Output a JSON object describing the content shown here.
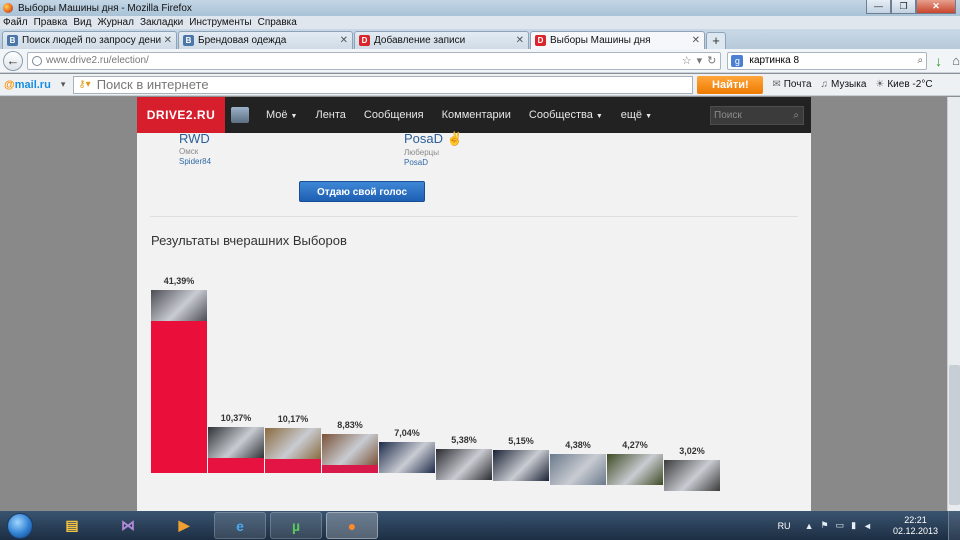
{
  "window": {
    "title": "Выборы Машины дня - Mozilla Firefox"
  },
  "menu": [
    "Файл",
    "Правка",
    "Вид",
    "Журнал",
    "Закладки",
    "Инструменты",
    "Справка"
  ],
  "tabs": [
    {
      "label": "Поиск людей по запросу денис сол...",
      "favicon": "В",
      "favicon_kind": "vk"
    },
    {
      "label": "Брендовая одежда",
      "favicon": "В",
      "favicon_kind": "vk"
    },
    {
      "label": "Добавление записи",
      "favicon": "D",
      "favicon_kind": "d2"
    },
    {
      "label": "Выборы Машины дня",
      "favicon": "D",
      "favicon_kind": "d2",
      "active": true
    }
  ],
  "nav": {
    "url": "www.drive2.ru/election/",
    "search_value": "картинка 8"
  },
  "mailbar": {
    "logo_text": "mail",
    "logo_tld": ".ru",
    "search_placeholder": "Поиск в интернете",
    "find_button": "Найти!",
    "mail_label": "Почта",
    "music_label": "Музыка",
    "weather_label": "Киев -2°С"
  },
  "site": {
    "logo": "DRIVE2.RU",
    "nav": [
      "Моё",
      "Лента",
      "Сообщения",
      "Комментарии",
      "Сообщества",
      "ещё"
    ],
    "search_placeholder": "Поиск",
    "candidates": [
      {
        "name": "RWD",
        "city": "Омск",
        "user": "Spider84"
      },
      {
        "name": "PosaD",
        "city": "Люберцы",
        "user": "PosaD"
      }
    ],
    "vote_button": "Отдаю свой голос",
    "results_title": "Результаты вчерашних Выборов"
  },
  "chart_data": {
    "type": "bar",
    "title": "Результаты вчерашних Выборов",
    "values": [
      41.39,
      10.37,
      10.17,
      8.83,
      7.04,
      5.38,
      5.15,
      4.38,
      4.27,
      3.02
    ],
    "labels": [
      "41,39%",
      "10,37%",
      "10,17%",
      "8,83%",
      "7,04%",
      "5,38%",
      "5,15%",
      "4,38%",
      "4,27%",
      "3,02%"
    ],
    "colors": [
      "#ea0f3a",
      "#e71240",
      "#e21545",
      "#d81a4a",
      "#cb2050",
      "#b92a58",
      "#a4355f",
      "#8c4167",
      "#764c6e",
      "#605676"
    ]
  },
  "taskbar": {
    "lang": "RU",
    "time": "22:21",
    "date": "02.12.2013",
    "apps": [
      "folder-icon",
      "visual-studio-icon",
      "media-player-icon",
      "internet-explorer-icon",
      "utorrent-icon",
      "firefox-icon"
    ]
  }
}
